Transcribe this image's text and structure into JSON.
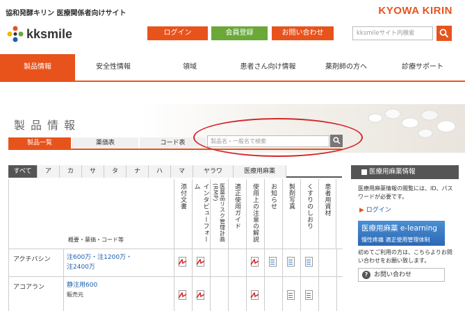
{
  "header": {
    "site_label": "協和発酵キリン 医療関係者向けサイト",
    "corp_logo": "KYOWA KIRIN",
    "logo_text": "kksmile",
    "buttons": {
      "login": "ログイン",
      "register": "会員登録",
      "contact": "お問い合わせ"
    },
    "search_placeholder": "kksmileサイト内検索"
  },
  "nav": [
    "製品情報",
    "安全性情報",
    "領域",
    "患者さん向け情報",
    "薬剤師の方へ",
    "診療サポート"
  ],
  "page_title": "製品情報",
  "subtabs": [
    "製品一覧",
    "薬価表",
    "コード表"
  ],
  "product_search_placeholder": "製品名・一般名で検索",
  "kana_tabs": [
    "すべて",
    "ア",
    "カ",
    "サ",
    "タ",
    "ナ",
    "ハ",
    "マ",
    "ヤラワ",
    "医療用麻薬"
  ],
  "table": {
    "summary_header": "概要・薬価・コード等",
    "columns": [
      "添付文書",
      "インタビューフォーム",
      "医薬品リスク管理計画(RMP)",
      "適正使用ガイド",
      "使用上の注意の解説",
      "お知らせ",
      "製剤写真",
      "くすりのしおり",
      "患者用資材"
    ],
    "rows": [
      {
        "name": "アクチバシン",
        "links": [
          "注600万・注1200万・",
          "注2400万"
        ]
      },
      {
        "name": "アコアラン",
        "links": [
          "静注用600"
        ],
        "sub": "販売元"
      }
    ]
  },
  "sidebar": {
    "title": "医療用麻薬情報",
    "text": "医療用麻薬情報の閲覧には、ID、パスワードが必要です。",
    "login": "ログイン",
    "elearning_1": "医療用麻薬 e-learning",
    "elearning_2": "慢性疼痛 適正使用管理体制",
    "note": "初めてご利用の方は、こちらよりお問い合わせをお願い致します。",
    "contact_button": "お問い合わせ"
  },
  "colors": {
    "accent": "#e8531c",
    "green": "#6aa83a",
    "link": "#1b5fae",
    "ellipse": "#d4262a"
  }
}
